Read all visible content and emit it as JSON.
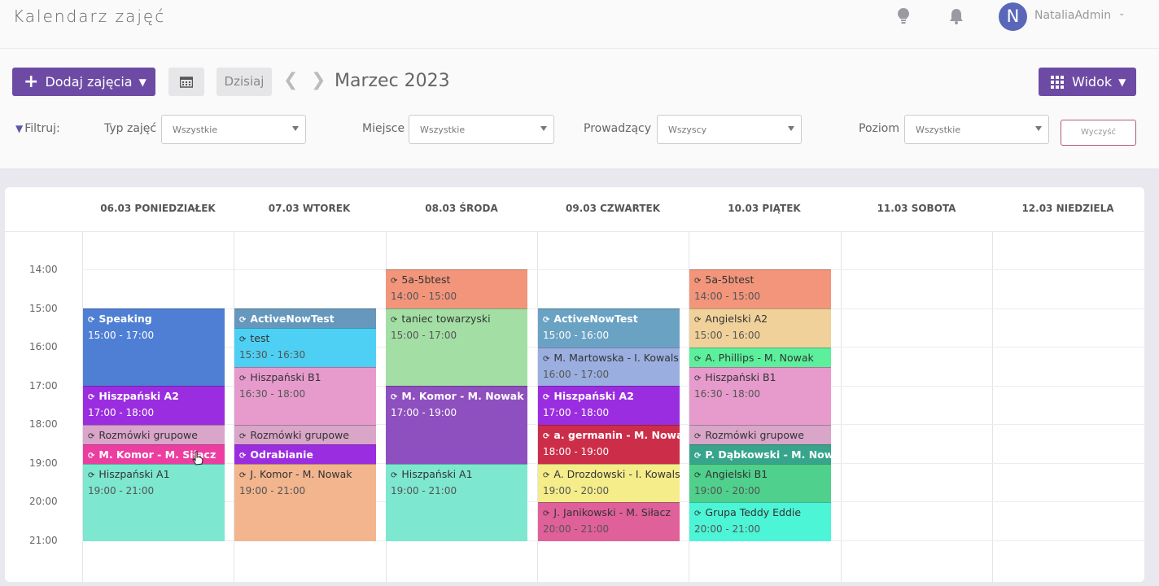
{
  "header": {
    "title": "Kalendarz zajęć",
    "user": {
      "initial": "N",
      "name": "NataliaAdmin"
    }
  },
  "toolbar": {
    "add_label": "Dodaj zajęcia",
    "today_label": "Dzisiaj",
    "month": "Marzec 2023",
    "view_label": "Widok"
  },
  "filters": {
    "label": "Filtruj:",
    "type": {
      "label": "Typ zajęć",
      "value": "Wszystkie"
    },
    "place": {
      "label": "Miejsce",
      "value": "Wszystkie"
    },
    "teacher": {
      "label": "Prowadzący",
      "value": "Wszyscy"
    },
    "level": {
      "label": "Poziom",
      "value": "Wszystkie"
    },
    "clear_label": "Wyczyść"
  },
  "calendar": {
    "days": [
      "06.03 PONIEDZIAŁEK",
      "07.03 WTOREK",
      "08.03 ŚRODA",
      "09.03 CZWARTEK",
      "10.03 PIĄTEK",
      "11.03 SOBOTA",
      "12.03 NIEDZIELA"
    ],
    "hours": [
      "14:00",
      "15:00",
      "16:00",
      "17:00",
      "18:00",
      "19:00",
      "20:00",
      "21:00"
    ],
    "events": {
      "mon": [
        {
          "title": "Speaking",
          "time": "15:00 - 17:00",
          "color": "#4f7fd4"
        },
        {
          "title": "Hiszpański A2",
          "time": "17:00 - 18:00",
          "color": "#9b2de0"
        },
        {
          "title": "Rozmówki grupowe",
          "time": "",
          "color": "#d9a5c9"
        },
        {
          "title": "M. Komor - M. Siłacz",
          "time": "",
          "color": "#ec3ea1"
        },
        {
          "title": "Hiszpański A1",
          "time": "19:00 - 21:00",
          "color": "#7de7cf"
        }
      ],
      "tue": [
        {
          "title": "ActiveNowTest",
          "time": "",
          "color": "#6698bd"
        },
        {
          "title": "test",
          "time": "15:30 - 16:30",
          "color": "#4dd0f3"
        },
        {
          "title": "Hiszpański B1",
          "time": "16:30 - 18:00",
          "color": "#e69bcc"
        },
        {
          "title": "Rozmówki grupowe",
          "time": "",
          "color": "#d9a5c9"
        },
        {
          "title": "Odrabianie",
          "time": "",
          "color": "#9b2de0"
        },
        {
          "title": "J. Komor - M. Nowak",
          "time": "19:00 - 21:00",
          "color": "#f2b58e"
        }
      ],
      "wed": [
        {
          "title": "5a-5btest",
          "time": "14:00 - 15:00",
          "color": "#f2957b"
        },
        {
          "title": "taniec towarzyski",
          "time": "15:00 - 17:00",
          "color": "#a3dfa5"
        },
        {
          "title": "M. Komor - M. Nowak",
          "time": "17:00 - 19:00",
          "color": "#8e4fbf"
        },
        {
          "title": "Hiszpański A1",
          "time": "19:00 - 21:00",
          "color": "#7de7cf"
        }
      ],
      "thu": [
        {
          "title": "ActiveNowTest",
          "time": "15:00 - 16:00",
          "color": "#6aa2c4"
        },
        {
          "title": "M. Martowska - I. Kowalska",
          "time": "16:00 - 17:00",
          "color": "#9aaee0"
        },
        {
          "title": "Hiszpański A2",
          "time": "17:00 - 18:00",
          "color": "#9b2de0"
        },
        {
          "title": "a. germanin - M. Nowak",
          "time": "18:00 - 19:00",
          "color": "#cc2e4a"
        },
        {
          "title": "A. Drozdowski - I. Kowalska",
          "time": "19:00 - 20:00",
          "color": "#f5ec8a"
        },
        {
          "title": "J. Janikowski - M. Siłacz",
          "time": "20:00 - 21:00",
          "color": "#e0609a"
        }
      ],
      "fri": [
        {
          "title": "5a-5btest",
          "time": "14:00 - 15:00",
          "color": "#f2957b"
        },
        {
          "title": "Angielski A2",
          "time": "15:00 - 16:00",
          "color": "#f0d19a"
        },
        {
          "title": "A. Phillips - M. Nowak",
          "time": "",
          "color": "#5cf09c"
        },
        {
          "title": "Hiszpański B1",
          "time": "16:30 - 18:00",
          "color": "#e69bcc"
        },
        {
          "title": "Rozmówki grupowe",
          "time": "",
          "color": "#d9a5c9"
        },
        {
          "title": "P. Dąbkowski - M. Nowak",
          "time": "",
          "color": "#36a58c"
        },
        {
          "title": "Angielski B1",
          "time": "19:00 - 20:00",
          "color": "#4fd08c"
        },
        {
          "title": "Grupa Teddy Eddie",
          "time": "20:00 - 21:00",
          "color": "#4cf5d6"
        }
      ]
    }
  }
}
